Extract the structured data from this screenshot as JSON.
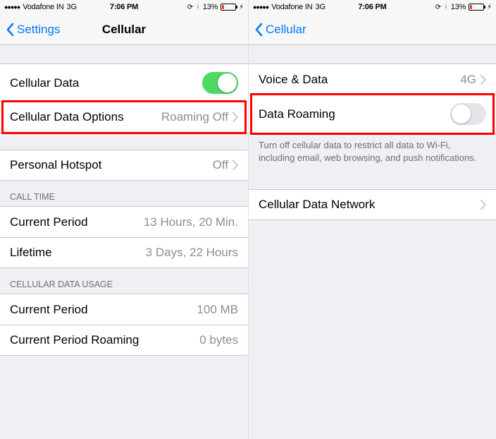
{
  "status": {
    "carrier": "Vodafone IN",
    "network": "3G",
    "time": "7:06 PM",
    "batteryPct": "13%"
  },
  "left": {
    "backLabel": "Settings",
    "title": "Cellular",
    "rows": {
      "cellularData": {
        "label": "Cellular Data",
        "on": true
      },
      "cellularDataOptions": {
        "label": "Cellular Data Options",
        "detail": "Roaming Off"
      },
      "personalHotspot": {
        "label": "Personal Hotspot",
        "detail": "Off"
      }
    },
    "callTime": {
      "header": "CALL TIME",
      "currentPeriod": {
        "label": "Current Period",
        "value": "13 Hours, 20 Min."
      },
      "lifetime": {
        "label": "Lifetime",
        "value": "3 Days, 22 Hours"
      }
    },
    "dataUsage": {
      "header": "CELLULAR DATA USAGE",
      "currentPeriod": {
        "label": "Current Period",
        "value": "100 MB"
      },
      "currentPeriodRoaming": {
        "label": "Current Period Roaming",
        "value": "0 bytes"
      }
    }
  },
  "right": {
    "backLabel": "Cellular",
    "rows": {
      "voiceData": {
        "label": "Voice & Data",
        "detail": "4G"
      },
      "dataRoaming": {
        "label": "Data Roaming",
        "on": false
      }
    },
    "footerText": "Turn off cellular data to restrict all data to Wi-Fi, including email, web browsing, and push notifications.",
    "cellularDataNetwork": {
      "label": "Cellular Data Network"
    }
  }
}
